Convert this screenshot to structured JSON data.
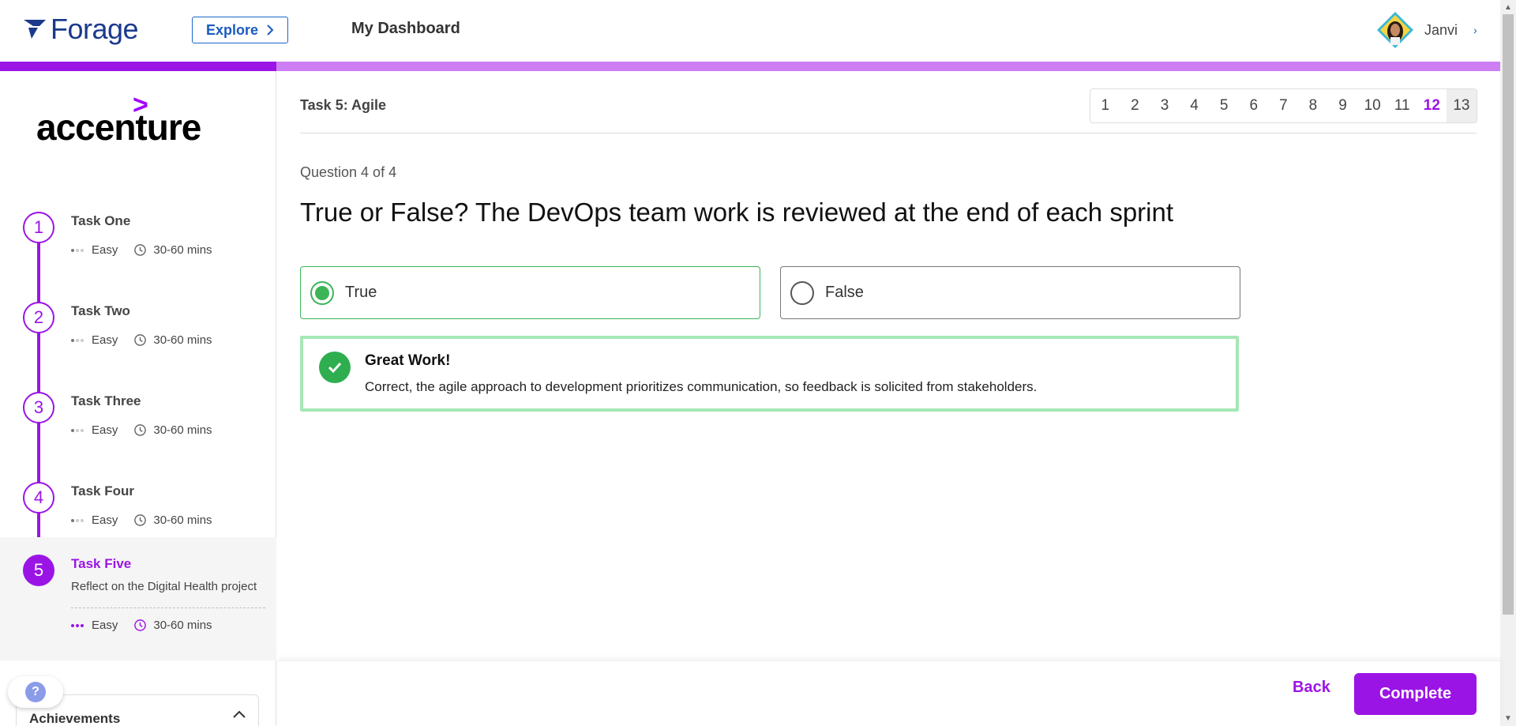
{
  "header": {
    "brand": "Forage",
    "explore_label": "Explore",
    "dashboard_label": "My Dashboard",
    "user_name": "Janvi"
  },
  "progress": {
    "fraction": 0.184
  },
  "sidebar": {
    "company_logo": "accenture",
    "tasks": [
      {
        "number": "1",
        "title": "Task One",
        "difficulty": "Easy",
        "duration": "30-60 mins"
      },
      {
        "number": "2",
        "title": "Task Two",
        "difficulty": "Easy",
        "duration": "30-60 mins"
      },
      {
        "number": "3",
        "title": "Task Three",
        "difficulty": "Easy",
        "duration": "30-60 mins"
      },
      {
        "number": "4",
        "title": "Task Four",
        "difficulty": "Easy",
        "duration": "30-60 mins"
      },
      {
        "number": "5",
        "title": "Task Five",
        "description": "Reflect on the Digital Health project",
        "difficulty": "Easy",
        "duration": "30-60 mins",
        "active": true
      }
    ],
    "help_icon": "?",
    "achievements_label": "Achievements"
  },
  "main": {
    "task_heading": "Task 5: Agile",
    "pages": [
      "1",
      "2",
      "3",
      "4",
      "5",
      "6",
      "7",
      "8",
      "9",
      "10",
      "11",
      "12",
      "13"
    ],
    "current_page": "12",
    "question_count": "Question 4 of 4",
    "question": "True or False? The DevOps team work is reviewed at the end of each sprint",
    "options": [
      {
        "label": "True",
        "selected": true
      },
      {
        "label": "False",
        "selected": false
      }
    ],
    "feedback": {
      "title": "Great Work!",
      "body": "Correct, the agile approach to development prioritizes communication, so feedback is solicited from stakeholders."
    }
  },
  "footer": {
    "back_label": "Back",
    "complete_label": "Complete"
  },
  "colors": {
    "brand_purple": "#9b14e6",
    "success_green": "#3cb556",
    "forage_blue": "#1b3a8c"
  }
}
